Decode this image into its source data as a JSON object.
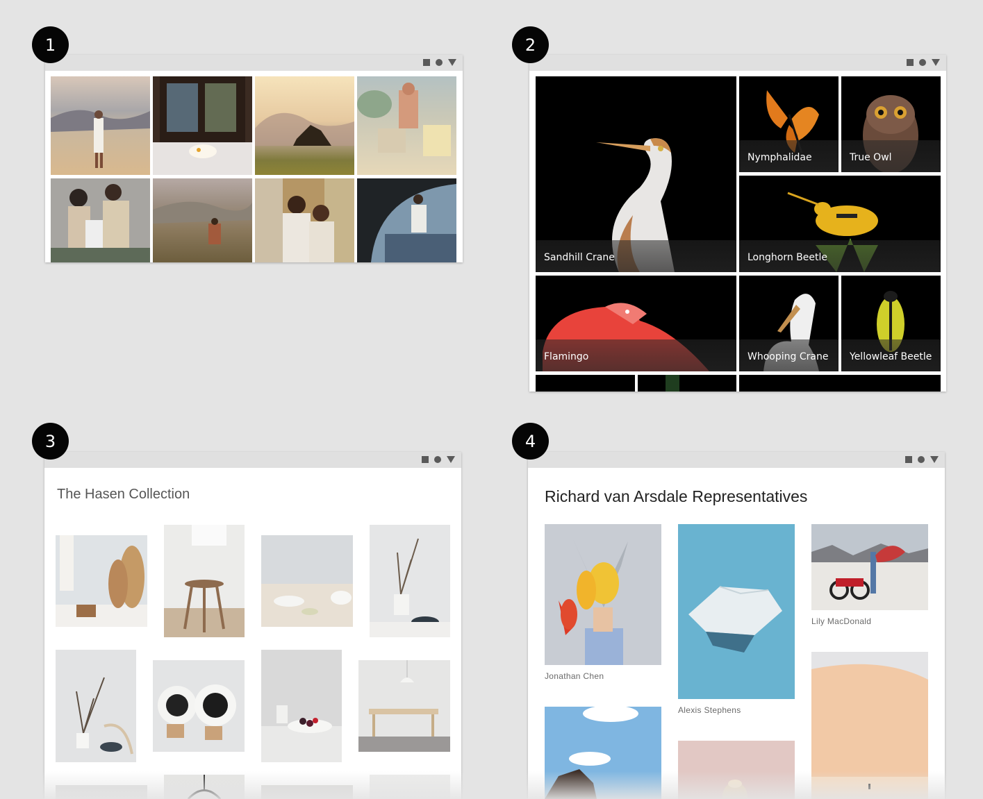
{
  "badges": [
    "1",
    "2",
    "3",
    "4"
  ],
  "window_controls": [
    "square-icon",
    "circle-icon",
    "triangle-icon"
  ],
  "panel2": {
    "captions": [
      "Sandhill Crane",
      "Nymphalidae",
      "True Owl",
      "Longhorn Beetle",
      "Flamingo",
      "Whooping Crane",
      "Yellowleaf Beetle"
    ]
  },
  "panel3": {
    "title": "The Hasen Collection"
  },
  "panel4": {
    "title": "Richard van Arsdale Representatives",
    "photographers": [
      "Jonathan Chen",
      "Lily MacDonald",
      "Alexis Stephens"
    ]
  }
}
